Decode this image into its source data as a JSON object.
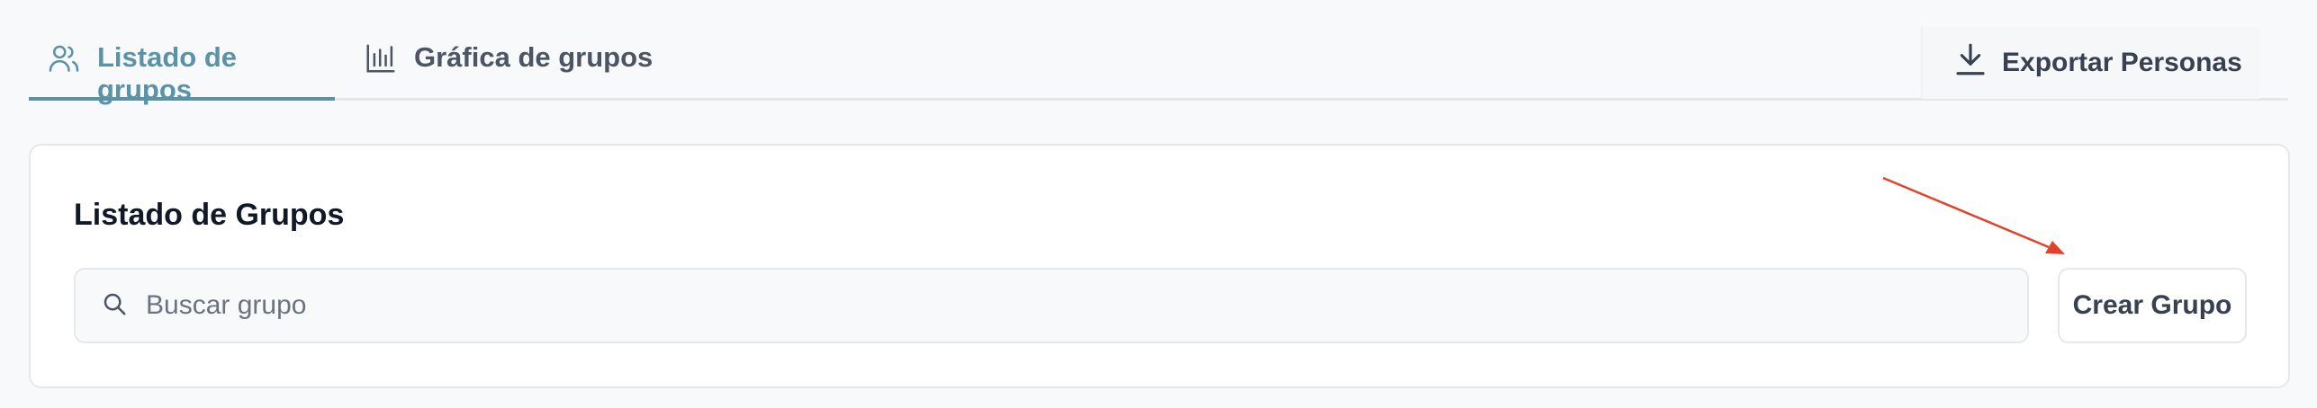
{
  "tabs": [
    {
      "label": "Listado de grupos",
      "icon": "users-icon",
      "active": true
    },
    {
      "label": "Gráfica de grupos",
      "icon": "bar-chart-icon",
      "active": false
    }
  ],
  "export": {
    "label": "Exportar Personas",
    "icon": "download-icon"
  },
  "card": {
    "title": "Listado de Grupos",
    "search": {
      "placeholder": "Buscar grupo",
      "value": ""
    },
    "create_label": "Crear Grupo"
  },
  "colors": {
    "accent": "#5a93a8",
    "annotation": "#e4412b"
  }
}
